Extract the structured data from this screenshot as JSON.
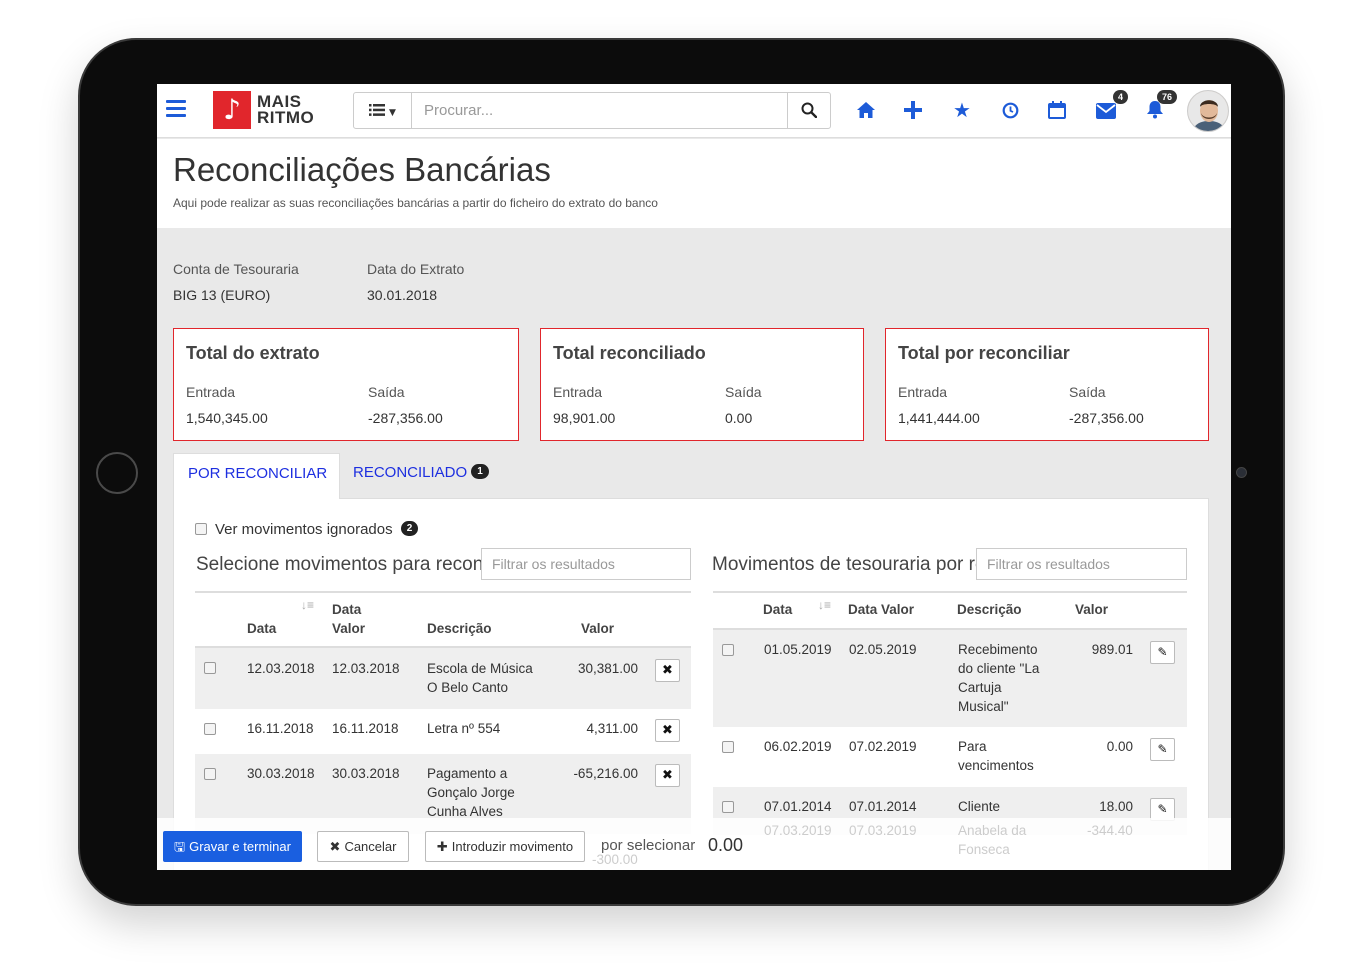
{
  "navbar": {
    "logo_line1": "MAIS",
    "logo_line2": "RITMO",
    "search_placeholder": "Procurar...",
    "mail_count": "4",
    "notif_count": "76",
    "accent_color": "#1d5bd8",
    "icons": [
      "hamburger-icon",
      "list-icon",
      "search-icon",
      "home-icon",
      "plus-icon",
      "star-icon",
      "clock-icon",
      "calendar-icon",
      "mail-icon",
      "bell-icon"
    ]
  },
  "header": {
    "title": "Reconciliações Bancárias",
    "subtitle": "Aqui pode realizar as suas reconciliações bancárias a partir do ficheiro do extrato do banco"
  },
  "info": {
    "account_label": "Conta de Tesouraria",
    "account_value": "BIG 13 (EURO)",
    "date_label": "Data do Extrato",
    "date_value": "30.01.2018"
  },
  "cards": [
    {
      "title": "Total do extrato",
      "in_label": "Entrada",
      "in_value": "1,540,345.00",
      "out_label": "Saída",
      "out_value": "-287,356.00"
    },
    {
      "title": "Total reconciliado",
      "in_label": "Entrada",
      "in_value": "98,901.00",
      "out_label": "Saída",
      "out_value": "0.00"
    },
    {
      "title": "Total por reconciliar",
      "in_label": "Entrada",
      "in_value": "1,441,444.00",
      "out_label": "Saída",
      "out_value": "-287,356.00"
    }
  ],
  "tabs": {
    "active": "POR RECONCILIAR",
    "second": "RECONCILIADO",
    "second_badge": "1"
  },
  "ignored": {
    "label": "Ver movimentos ignorados",
    "badge": "2"
  },
  "left_table": {
    "title": "Selecione movimentos para reconciliar",
    "filter_placeholder": "Filtrar os resultados",
    "headers": {
      "date": "Data",
      "value_date_1": "Data",
      "value_date_2": "Valor",
      "description": "Descrição",
      "amount": "Valor"
    },
    "rows": [
      {
        "date": "12.03.2018",
        "value_date": "12.03.2018",
        "desc_1": "Escola de Música",
        "desc_2": "O Belo Canto",
        "desc_3": "",
        "amount": "30,381.00"
      },
      {
        "date": "16.11.2018",
        "value_date": "16.11.2018",
        "desc_1": "Letra nº 554",
        "desc_2": "",
        "desc_3": "",
        "amount": "4,311.00"
      },
      {
        "date": "30.03.2018",
        "value_date": "30.03.2018",
        "desc_1": "Pagamento a",
        "desc_2": "Gonçalo Jorge",
        "desc_3": "Cunha Alves",
        "amount": "-65,216.00"
      }
    ],
    "faded_amount": "-300.00"
  },
  "right_table": {
    "title": "Movimentos de tesouraria por reconciliar",
    "filter_placeholder": "Filtrar os resultados",
    "headers": {
      "date": "Data",
      "value_date": "Data Valor",
      "description": "Descrição",
      "amount": "Valor"
    },
    "rows": [
      {
        "date": "01.05.2019",
        "value_date": "02.05.2019",
        "desc_1": "Recebimento",
        "desc_2": "do cliente \"La",
        "desc_3": "Cartuja",
        "desc_4": "Musical\"",
        "amount": "989.01"
      },
      {
        "date": "06.02.2019",
        "value_date": "07.02.2019",
        "desc_1": "Para",
        "desc_2": "vencimentos",
        "desc_3": "",
        "desc_4": "",
        "amount": "0.00"
      },
      {
        "date": "07.01.2014",
        "value_date": "07.01.2014",
        "desc_1": "Cliente",
        "desc_2": "",
        "desc_3": "",
        "desc_4": "",
        "amount": "18.00"
      }
    ],
    "faded_row": {
      "date": "07.03.2019",
      "value_date": "07.03.2019",
      "desc_1": "Anabela da",
      "desc_2": "Fonseca",
      "amount": "-344.40"
    }
  },
  "footer": {
    "save_label": "Gravar e terminar",
    "cancel_label": "Cancelar",
    "add_label": "Introduzir movimento",
    "selected_label": "por selecionar",
    "selected_value": "0.00"
  }
}
